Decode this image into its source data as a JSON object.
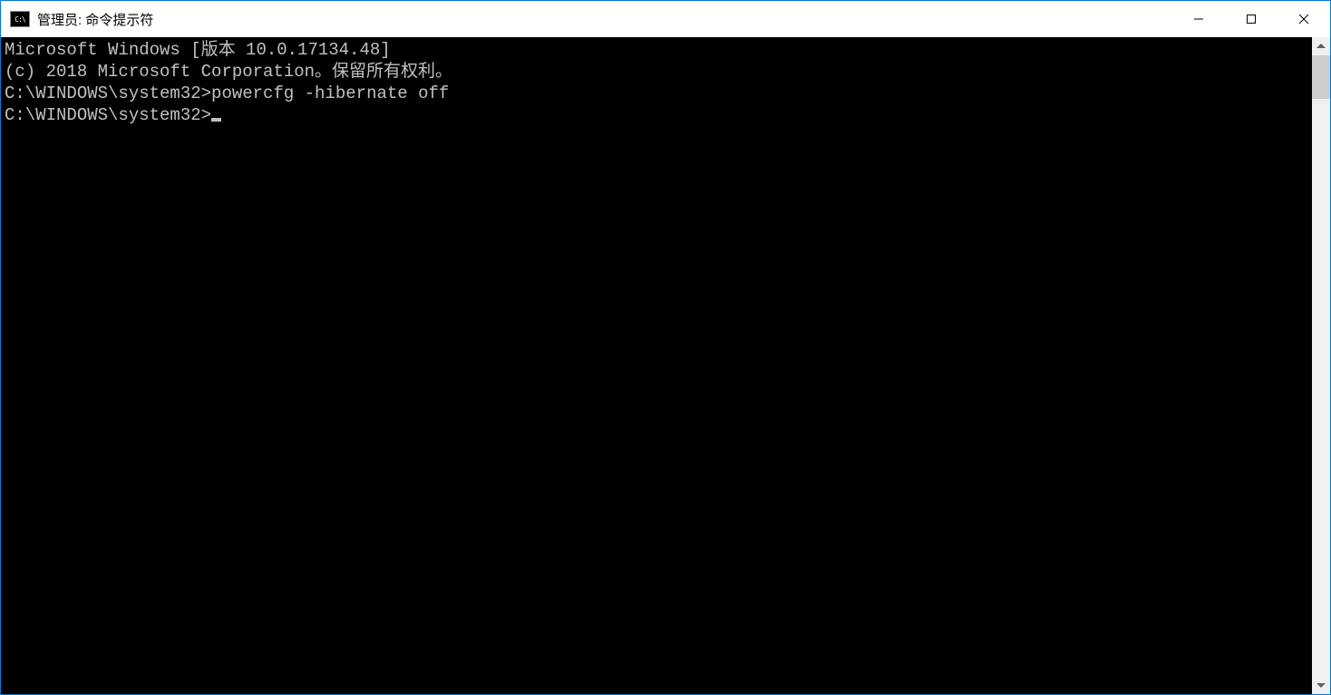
{
  "window": {
    "title": "管理员: 命令提示符"
  },
  "terminal": {
    "lines": [
      "Microsoft Windows [版本 10.0.17134.48]",
      "(c) 2018 Microsoft Corporation。保留所有权利。",
      "",
      "C:\\WINDOWS\\system32>powercfg -hibernate off",
      ""
    ],
    "currentPrompt": "C:\\WINDOWS\\system32>"
  }
}
